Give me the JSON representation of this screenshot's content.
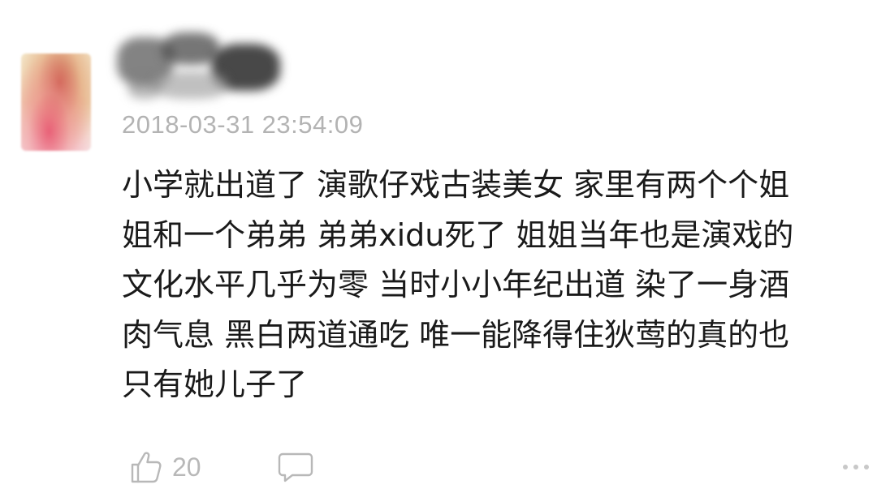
{
  "comment": {
    "timestamp": "2018-03-31 23:54:09",
    "lines": [
      "小学就出道了 演歌仔戏古装美女 家里有两个个姐",
      "姐和一个弟弟 弟弟xidu死了 姐姐当年也是演戏的",
      "文化水平几乎为零 当时小小年纪出道 染了一身酒",
      "肉气息 黑白两道通吃 唯一能降得住狄莺的真的也",
      "只有她儿子了"
    ],
    "likes": "20"
  },
  "icons": {
    "like": "thumbs-up-icon",
    "reply": "speech-bubble-icon",
    "more": "ellipsis-icon"
  },
  "colors": {
    "text": "#1a1a1a",
    "meta": "#b3b3b3",
    "icon": "#b8b8b8"
  }
}
